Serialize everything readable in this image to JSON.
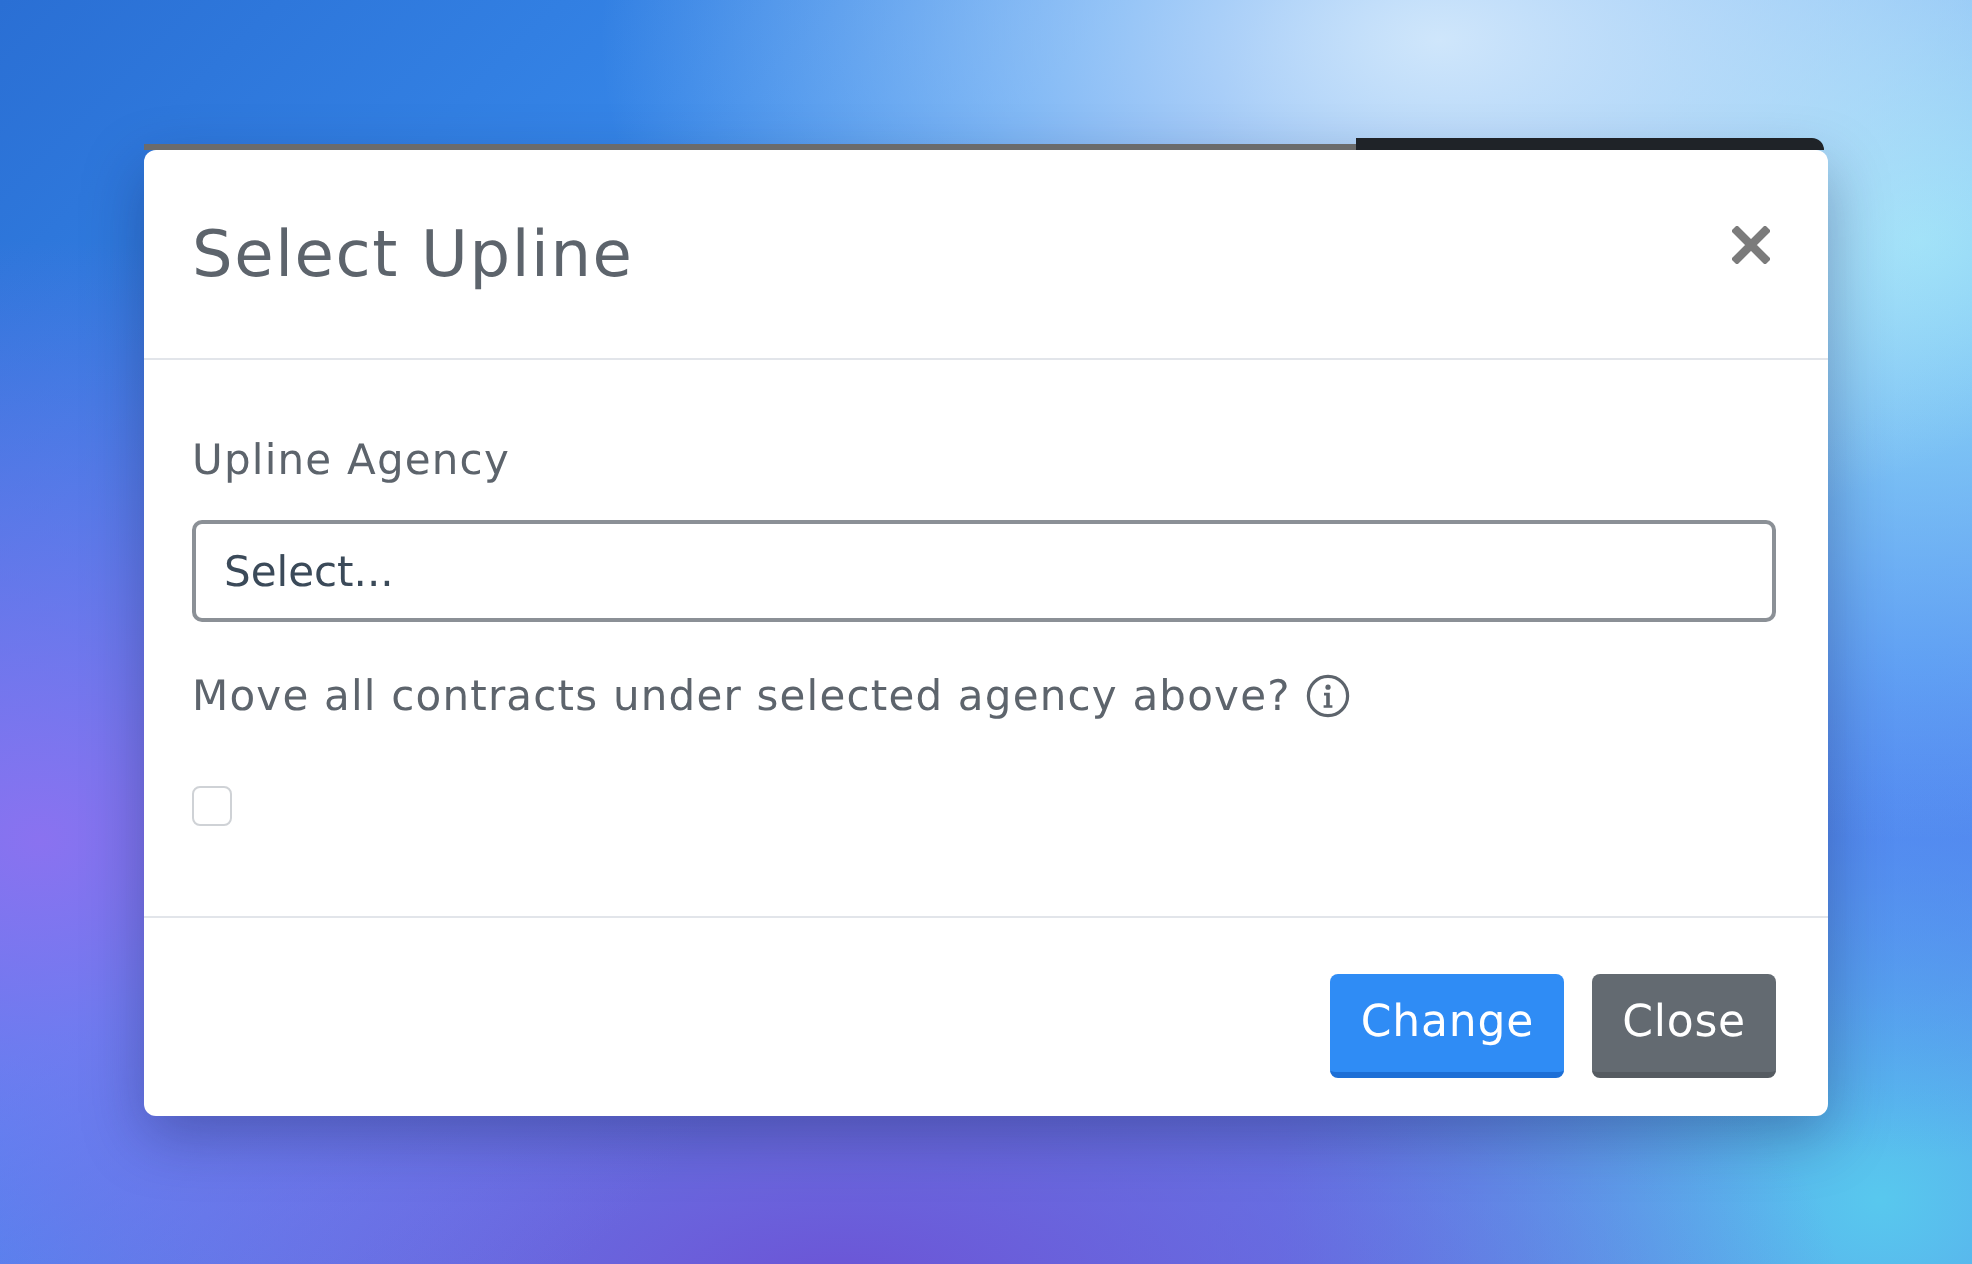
{
  "modal": {
    "title": "Select Upline"
  },
  "fields": [
    {
      "kind": "select",
      "label": "Upline Agency",
      "placeholder": "Select..."
    },
    {
      "kind": "checkbox",
      "label": "Move all contracts under selected agency above?",
      "checked": false
    }
  ],
  "buttons": [
    {
      "label": "Change",
      "kind": "primary"
    },
    {
      "label": "Close",
      "kind": "secondary"
    }
  ]
}
